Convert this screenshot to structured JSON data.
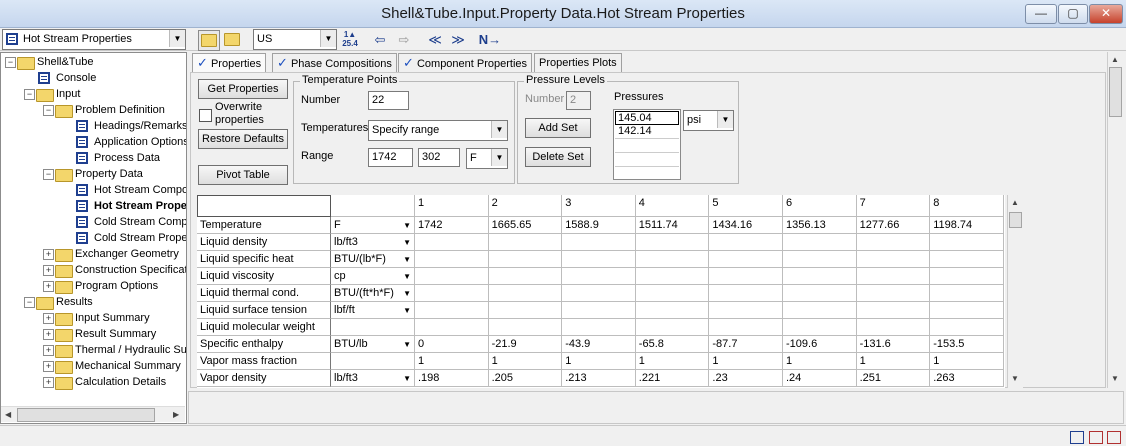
{
  "window": {
    "title": "Shell&Tube.Input.Property Data.Hot Stream Properties"
  },
  "window_buttons": {
    "minimize": "—",
    "maximize": "▢",
    "close": "✕"
  },
  "toolbar": {
    "form_selector": "Hot Stream Properties",
    "units_selector": "US",
    "nav_prev": "≪",
    "nav_next": "≫",
    "next_input": "N→"
  },
  "tree": {
    "items": [
      {
        "label": "Shell&Tube",
        "icon": "folder-icon",
        "level": 0,
        "expander": "−"
      },
      {
        "label": "Console",
        "icon": "form-icon",
        "level": 1,
        "expander": ""
      },
      {
        "label": "Input",
        "icon": "folder-icon",
        "level": 1,
        "expander": "−"
      },
      {
        "label": "Problem Definition",
        "icon": "folder-icon",
        "level": 2,
        "expander": "−"
      },
      {
        "label": "Headings/Remarks",
        "icon": "form-icon",
        "level": 3,
        "expander": ""
      },
      {
        "label": "Application Options",
        "icon": "form-icon",
        "level": 3,
        "expander": ""
      },
      {
        "label": "Process Data",
        "icon": "form-icon",
        "level": 3,
        "expander": ""
      },
      {
        "label": "Property Data",
        "icon": "folder-icon",
        "level": 2,
        "expander": "−"
      },
      {
        "label": "Hot Stream Composit",
        "icon": "form-icon",
        "level": 3,
        "expander": ""
      },
      {
        "label": "Hot Stream Prope",
        "icon": "form-icon",
        "level": 3,
        "expander": "",
        "selected": true
      },
      {
        "label": "Cold Stream Compos",
        "icon": "form-icon",
        "level": 3,
        "expander": ""
      },
      {
        "label": "Cold Stream Propertie",
        "icon": "form-icon",
        "level": 3,
        "expander": ""
      },
      {
        "label": "Exchanger Geometry",
        "icon": "folder-icon",
        "level": 2,
        "expander": "+"
      },
      {
        "label": "Construction Specificatio",
        "icon": "folder-icon",
        "level": 2,
        "expander": "+"
      },
      {
        "label": "Program Options",
        "icon": "folder-icon",
        "level": 2,
        "expander": "+"
      },
      {
        "label": "Results",
        "icon": "folder-icon",
        "level": 1,
        "expander": "−"
      },
      {
        "label": "Input Summary",
        "icon": "folder-icon",
        "level": 2,
        "expander": "+"
      },
      {
        "label": "Result Summary",
        "icon": "folder-icon",
        "level": 2,
        "expander": "+"
      },
      {
        "label": "Thermal / Hydraulic Sum",
        "icon": "folder-icon",
        "level": 2,
        "expander": "+"
      },
      {
        "label": "Mechanical Summary",
        "icon": "folder-icon",
        "level": 2,
        "expander": "+"
      },
      {
        "label": "Calculation Details",
        "icon": "folder-icon",
        "level": 2,
        "expander": "+"
      }
    ]
  },
  "tabs": [
    {
      "label": "Properties",
      "checked": true,
      "active": true
    },
    {
      "label": "Phase Compositions",
      "checked": true,
      "active": false
    },
    {
      "label": "Component Properties",
      "checked": true,
      "active": false
    },
    {
      "label": "Properties Plots",
      "checked": false,
      "active": false
    }
  ],
  "check_glyph": "✓",
  "buttons": {
    "get_properties": "Get Properties",
    "overwrite_properties": "Overwrite properties",
    "restore_defaults": "Restore Defaults",
    "pivot_table": "Pivot Table",
    "add_set": "Add Set",
    "delete_set": "Delete Set"
  },
  "temperature_points": {
    "title": "Temperature Points",
    "number_label": "Number",
    "number_value": "22",
    "temperatures_label": "Temperatures",
    "temperatures_mode": "Specify range",
    "range_label": "Range",
    "range_from": "1742",
    "range_to": "302",
    "range_unit": "F"
  },
  "pressure_levels": {
    "title": "Pressure Levels",
    "number_label": "Number",
    "number_value": "2",
    "pressures_label": "Pressures",
    "pressures": [
      "145.04",
      "142.14",
      "",
      ""
    ],
    "unit": "psi"
  },
  "grid": {
    "columns": [
      "1",
      "2",
      "3",
      "4",
      "5",
      "6",
      "7",
      "8"
    ],
    "rows": [
      {
        "name": "Temperature",
        "unit": "F",
        "has_dd": true,
        "values": [
          "1742",
          "1665.65",
          "1588.9",
          "1511.74",
          "1434.16",
          "1356.13",
          "1277.66",
          "1198.74"
        ]
      },
      {
        "name": "Liquid density",
        "unit": "lb/ft3",
        "has_dd": true,
        "values": [
          "",
          "",
          "",
          "",
          "",
          "",
          "",
          ""
        ]
      },
      {
        "name": "Liquid specific heat",
        "unit": "BTU/(lb*F)",
        "has_dd": true,
        "values": [
          "",
          "",
          "",
          "",
          "",
          "",
          "",
          ""
        ]
      },
      {
        "name": "Liquid viscosity",
        "unit": "cp",
        "has_dd": true,
        "values": [
          "",
          "",
          "",
          "",
          "",
          "",
          "",
          ""
        ]
      },
      {
        "name": "Liquid thermal cond.",
        "unit": "BTU/(ft*h*F)",
        "has_dd": true,
        "values": [
          "",
          "",
          "",
          "",
          "",
          "",
          "",
          ""
        ]
      },
      {
        "name": "Liquid surface tension",
        "unit": "lbf/ft",
        "has_dd": true,
        "values": [
          "",
          "",
          "",
          "",
          "",
          "",
          "",
          ""
        ]
      },
      {
        "name": "Liquid molecular weight",
        "unit": "",
        "has_dd": false,
        "values": [
          "",
          "",
          "",
          "",
          "",
          "",
          "",
          ""
        ]
      },
      {
        "name": "Specific enthalpy",
        "unit": "BTU/lb",
        "has_dd": true,
        "values": [
          "0",
          "-21.9",
          "-43.9",
          "-65.8",
          "-87.7",
          "-109.6",
          "-131.6",
          "-153.5"
        ]
      },
      {
        "name": "Vapor mass fraction",
        "unit": "",
        "has_dd": false,
        "values": [
          "1",
          "1",
          "1",
          "1",
          "1",
          "1",
          "1",
          "1"
        ]
      },
      {
        "name": "Vapor density",
        "unit": "lb/ft3",
        "has_dd": true,
        "values": [
          ".198",
          ".205",
          ".213",
          ".221",
          ".23",
          ".24",
          ".251",
          ".263"
        ]
      }
    ]
  },
  "dropdown_glyph": "▼"
}
